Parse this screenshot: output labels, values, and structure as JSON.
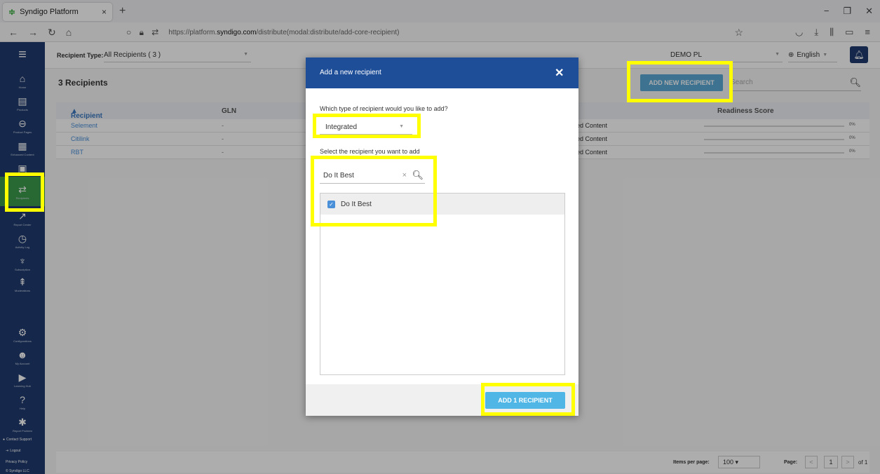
{
  "browser": {
    "tab_title": "Syndigo Platform",
    "tab_close": "×",
    "new_tab": "+",
    "url_prefix": "https://platform.",
    "url_host": "syndigo.com",
    "url_path": "/distribute(modal:distribute/add-core-recipient)"
  },
  "sidebar": {
    "items": [
      {
        "label": "Home",
        "icon": "home-icon"
      },
      {
        "label": "Products",
        "icon": "products-icon"
      },
      {
        "label": "Product Pages",
        "icon": "link-icon"
      },
      {
        "label": "Enhanced Content",
        "icon": "enhanced-content-icon"
      },
      {
        "label": "",
        "icon": "image-icon"
      },
      {
        "label": "Recipients",
        "icon": "recipients-icon"
      },
      {
        "label": "Report Center",
        "icon": "report-icon"
      },
      {
        "label": "Activity Log",
        "icon": "history-icon"
      },
      {
        "label": "Subscription",
        "icon": "antenna-icon"
      },
      {
        "label": "Moderations",
        "icon": "upload-icon"
      },
      {
        "label": "Configurations",
        "icon": "config-icon"
      },
      {
        "label": "My Account",
        "icon": "account-icon"
      },
      {
        "label": "Learning Hub",
        "icon": "learning-icon"
      },
      {
        "label": "Help",
        "icon": "help-icon"
      },
      {
        "label": "Report Problem",
        "icon": "bug-icon"
      }
    ],
    "contact_support": "Contact Support",
    "logout": "Logout",
    "privacy": "Privacy Policy",
    "copyright": "© Syndigo LLC"
  },
  "topbar": {
    "recipient_type_label": "Recipient Type:",
    "recipient_type_value": "All Recipients ( 3 )",
    "org_value": "DEMO PL",
    "language": "English"
  },
  "header": {
    "title": "3 Recipients",
    "add_new_button": "ADD NEW RECIPIENT",
    "search_placeholder": "Search"
  },
  "table": {
    "columns": {
      "recipient": "Recipient",
      "gln": "GLN",
      "readiness": "Readiness Score"
    },
    "rows": [
      {
        "name": "Selement",
        "gln": "-",
        "content": "ed Content",
        "pct": "0%"
      },
      {
        "name": "Citilink",
        "gln": "-",
        "content": "ed Content",
        "pct": "0%"
      },
      {
        "name": "RBT",
        "gln": "-",
        "content": "ed Content",
        "pct": "0%"
      }
    ]
  },
  "pagination": {
    "items_per_page_label": "Items per page:",
    "items_per_page": "100",
    "page_label": "Page:",
    "page": "1",
    "of": "of 1"
  },
  "modal": {
    "title": "Add a new recipient",
    "question_type": "Which type of recipient would you like to add?",
    "type_value": "Integrated",
    "question_select": "Select the recipient you want to add",
    "search_value": "Do It Best",
    "list_items": [
      {
        "label": "Do It Best",
        "checked": true
      }
    ],
    "add_button": "ADD 1 RECIPIENT"
  },
  "colors": {
    "sidebar": "#1f3a6e",
    "modal_header": "#1f4e99",
    "accent": "#4fb6e6",
    "active_nav": "#3b9a4b",
    "highlight": "#ffff00"
  }
}
